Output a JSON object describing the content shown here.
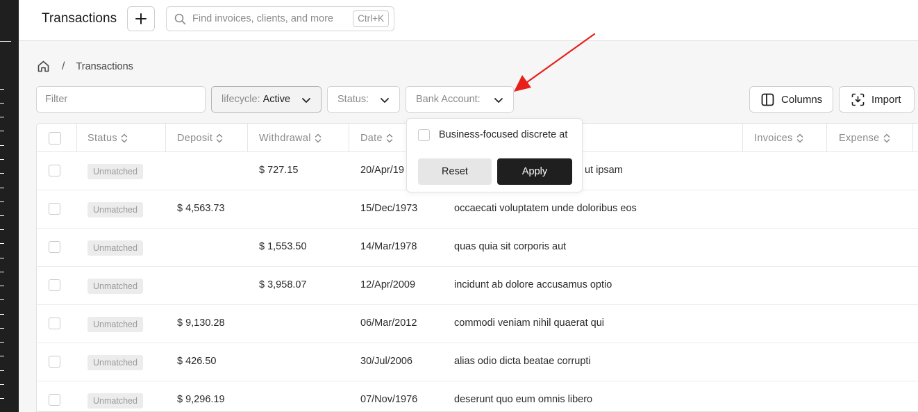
{
  "app": {
    "title": "Transactions",
    "search_placeholder": "Find invoices, clients, and more",
    "search_shortcut": "Ctrl+K"
  },
  "breadcrumb": {
    "separator": "/",
    "current": "Transactions"
  },
  "toolbar": {
    "filter_placeholder": "Filter",
    "lifecycle_key": "lifecycle:",
    "lifecycle_value": "Active",
    "status_label": "Status:",
    "bank_account_label": "Bank Account:",
    "columns_label": "Columns",
    "import_label": "Import"
  },
  "table": {
    "headers": [
      "Status",
      "Deposit",
      "Withdrawal",
      "Date",
      "Invoices",
      "Expense"
    ],
    "rows": [
      {
        "status": "Unmatched",
        "deposit": "",
        "withdrawal": "$ 727.15",
        "date": "20/Apr/19",
        "description": "ut ipsam"
      },
      {
        "status": "Unmatched",
        "deposit": "$ 4,563.73",
        "withdrawal": "",
        "date": "15/Dec/1973",
        "description": "occaecati voluptatem unde doloribus eos"
      },
      {
        "status": "Unmatched",
        "deposit": "",
        "withdrawal": "$ 1,553.50",
        "date": "14/Mar/1978",
        "description": "quas quia sit corporis aut"
      },
      {
        "status": "Unmatched",
        "deposit": "",
        "withdrawal": "$ 3,958.07",
        "date": "12/Apr/2009",
        "description": "incidunt ab dolore accusamus optio"
      },
      {
        "status": "Unmatched",
        "deposit": "$ 9,130.28",
        "withdrawal": "",
        "date": "06/Mar/2012",
        "description": "commodi veniam nihil quaerat qui"
      },
      {
        "status": "Unmatched",
        "deposit": "$ 426.50",
        "withdrawal": "",
        "date": "30/Jul/2006",
        "description": "alias odio dicta beatae corrupti"
      },
      {
        "status": "Unmatched",
        "deposit": "$ 9,296.19",
        "withdrawal": "",
        "date": "07/Nov/1976",
        "description": "deserunt quo eum omnis libero"
      }
    ]
  },
  "bank_popover": {
    "option": "Business-focused discrete at",
    "reset_label": "Reset",
    "apply_label": "Apply"
  },
  "colors": {
    "annotation_arrow": "#e8201a",
    "apply_bg": "#1f1f1f"
  }
}
